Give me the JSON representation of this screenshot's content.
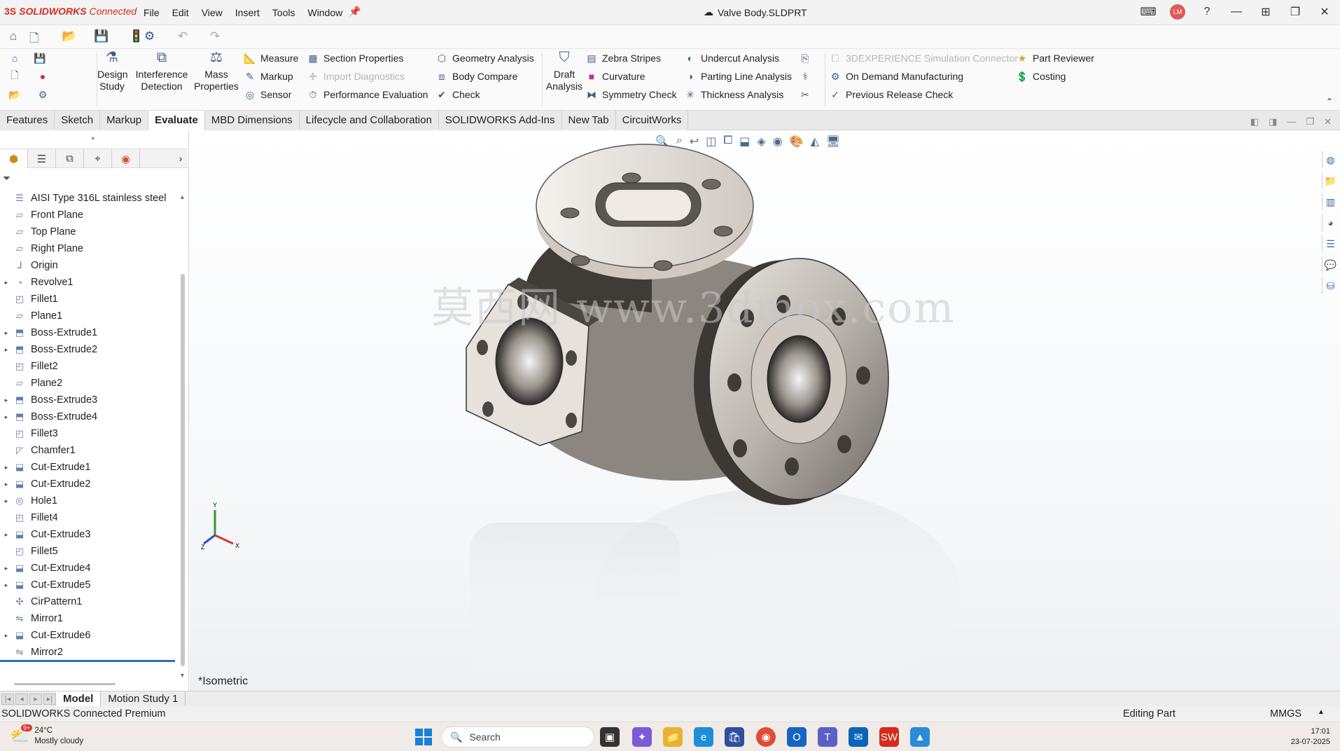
{
  "app": {
    "logo_ds": "3S",
    "logo_name": "SOLIDWORKS",
    "logo_suffix": "Connected",
    "document_title": "Valve Body.SLDPRT",
    "avatar_initials": "LM",
    "menu": [
      "File",
      "Edit",
      "View",
      "Insert",
      "Tools",
      "Window"
    ]
  },
  "ribbon": {
    "big_buttons": [
      {
        "label": "Design\nStudy",
        "icon": "design-study-icon"
      },
      {
        "label": "Interference\nDetection",
        "icon": "interference-icon"
      },
      {
        "label": "Mass\nProperties",
        "icon": "scale-icon"
      },
      {
        "label": "Draft\nAnalysis",
        "icon": "draft-icon"
      }
    ],
    "col1": [
      "Measure",
      "Markup",
      "Sensor"
    ],
    "col2": [
      "Section Properties",
      "Import Diagnostics",
      "Performance Evaluation"
    ],
    "col3": [
      "Geometry Analysis",
      "Body Compare",
      "Check"
    ],
    "col4": [
      "Zebra Stripes",
      "Curvature",
      "Symmetry Check"
    ],
    "col5": [
      "Undercut Analysis",
      "Parting Line Analysis",
      "Thickness Analysis"
    ],
    "col6": [
      "3DEXPERIENCE Simulation Connector",
      "On Demand Manufacturing",
      "Previous Release Check"
    ],
    "col7": [
      "Part Reviewer",
      "Costing"
    ]
  },
  "tabs": [
    "Features",
    "Sketch",
    "Markup",
    "Evaluate",
    "MBD Dimensions",
    "Lifecycle and Collaboration",
    "SOLIDWORKS Add-Ins",
    "New Tab",
    "CircuitWorks"
  ],
  "active_tab": "Evaluate",
  "tree": [
    {
      "label": "AISI Type 316L stainless steel",
      "icon": "material-icon",
      "expand": false
    },
    {
      "label": "Front Plane",
      "icon": "plane-icon",
      "expand": false
    },
    {
      "label": "Top Plane",
      "icon": "plane-icon",
      "expand": false
    },
    {
      "label": "Right Plane",
      "icon": "plane-icon",
      "expand": false
    },
    {
      "label": "Origin",
      "icon": "origin-icon",
      "expand": false
    },
    {
      "label": "Revolve1",
      "icon": "revolve-icon",
      "expand": true
    },
    {
      "label": "Fillet1",
      "icon": "fillet-icon",
      "expand": false
    },
    {
      "label": "Plane1",
      "icon": "plane-icon",
      "expand": false
    },
    {
      "label": "Boss-Extrude1",
      "icon": "extrude-icon",
      "expand": true
    },
    {
      "label": "Boss-Extrude2",
      "icon": "extrude-icon",
      "expand": true
    },
    {
      "label": "Fillet2",
      "icon": "fillet-icon",
      "expand": false
    },
    {
      "label": "Plane2",
      "icon": "plane-icon",
      "expand": false
    },
    {
      "label": "Boss-Extrude3",
      "icon": "extrude-icon",
      "expand": true
    },
    {
      "label": "Boss-Extrude4",
      "icon": "extrude-icon",
      "expand": true
    },
    {
      "label": "Fillet3",
      "icon": "fillet-icon",
      "expand": false
    },
    {
      "label": "Chamfer1",
      "icon": "chamfer-icon",
      "expand": false
    },
    {
      "label": "Cut-Extrude1",
      "icon": "cut-icon",
      "expand": true
    },
    {
      "label": "Cut-Extrude2",
      "icon": "cut-icon",
      "expand": true
    },
    {
      "label": "Hole1",
      "icon": "hole-icon",
      "expand": true
    },
    {
      "label": "Fillet4",
      "icon": "fillet-icon",
      "expand": false
    },
    {
      "label": "Cut-Extrude3",
      "icon": "cut-icon",
      "expand": true
    },
    {
      "label": "Fillet5",
      "icon": "fillet-icon",
      "expand": false
    },
    {
      "label": "Cut-Extrude4",
      "icon": "cut-icon",
      "expand": true
    },
    {
      "label": "Cut-Extrude5",
      "icon": "cut-icon",
      "expand": true
    },
    {
      "label": "CirPattern1",
      "icon": "pattern-icon",
      "expand": false
    },
    {
      "label": "Mirror1",
      "icon": "mirror-icon",
      "expand": false
    },
    {
      "label": "Cut-Extrude6",
      "icon": "cut-icon",
      "expand": true
    },
    {
      "label": "Mirror2",
      "icon": "mirror-icon",
      "expand": false
    }
  ],
  "viewport": {
    "view_name": "*Isometric",
    "watermark": "莫西网 www.3dmox.com",
    "triad": {
      "x": "X",
      "y": "Y",
      "z": "Z"
    }
  },
  "model_tabs": [
    "Model",
    "Motion Study 1"
  ],
  "status": {
    "product": "SOLIDWORKS Connected Premium",
    "mode": "Editing Part",
    "units": "MMGS"
  },
  "taskbar": {
    "temp": "24°C",
    "weather": "Mostly cloudy",
    "weather_badge": "9+",
    "search": "Search",
    "time": "17:01",
    "date": "23-07-2025"
  },
  "colors": {
    "brand_red": "#d42b1e",
    "accent_blue": "#2f6fb8",
    "model_metal": "#b9b4ad"
  }
}
